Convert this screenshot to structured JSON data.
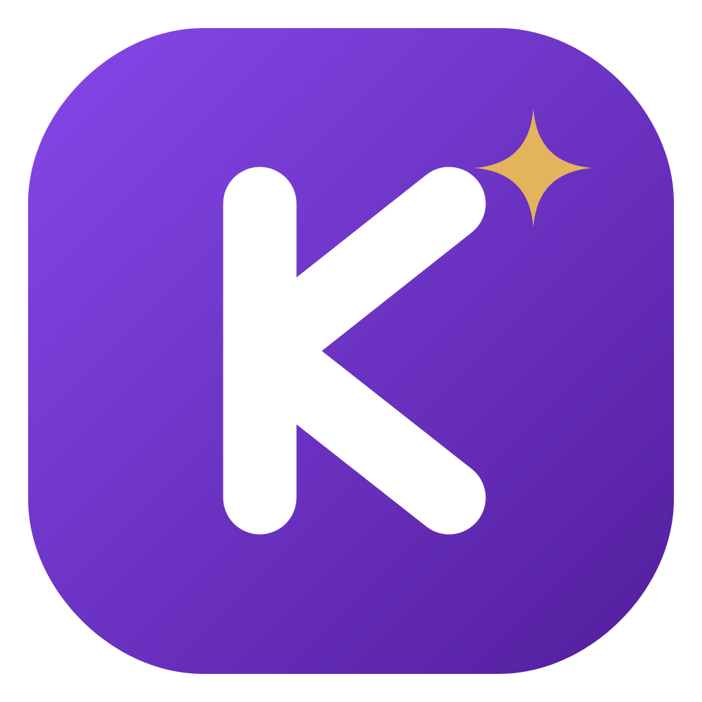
{
  "app_icon": {
    "letter": "K",
    "icon_name": "k-letter-with-sparkle-icon",
    "sparkle_icon_name": "four-point-star-sparkle-icon",
    "colors": {
      "page_background": "#ffffff",
      "gradient_start": "#8548ea",
      "gradient_end": "#531e9c",
      "letter": "#ffffff",
      "sparkle": "#e3b45c"
    }
  }
}
